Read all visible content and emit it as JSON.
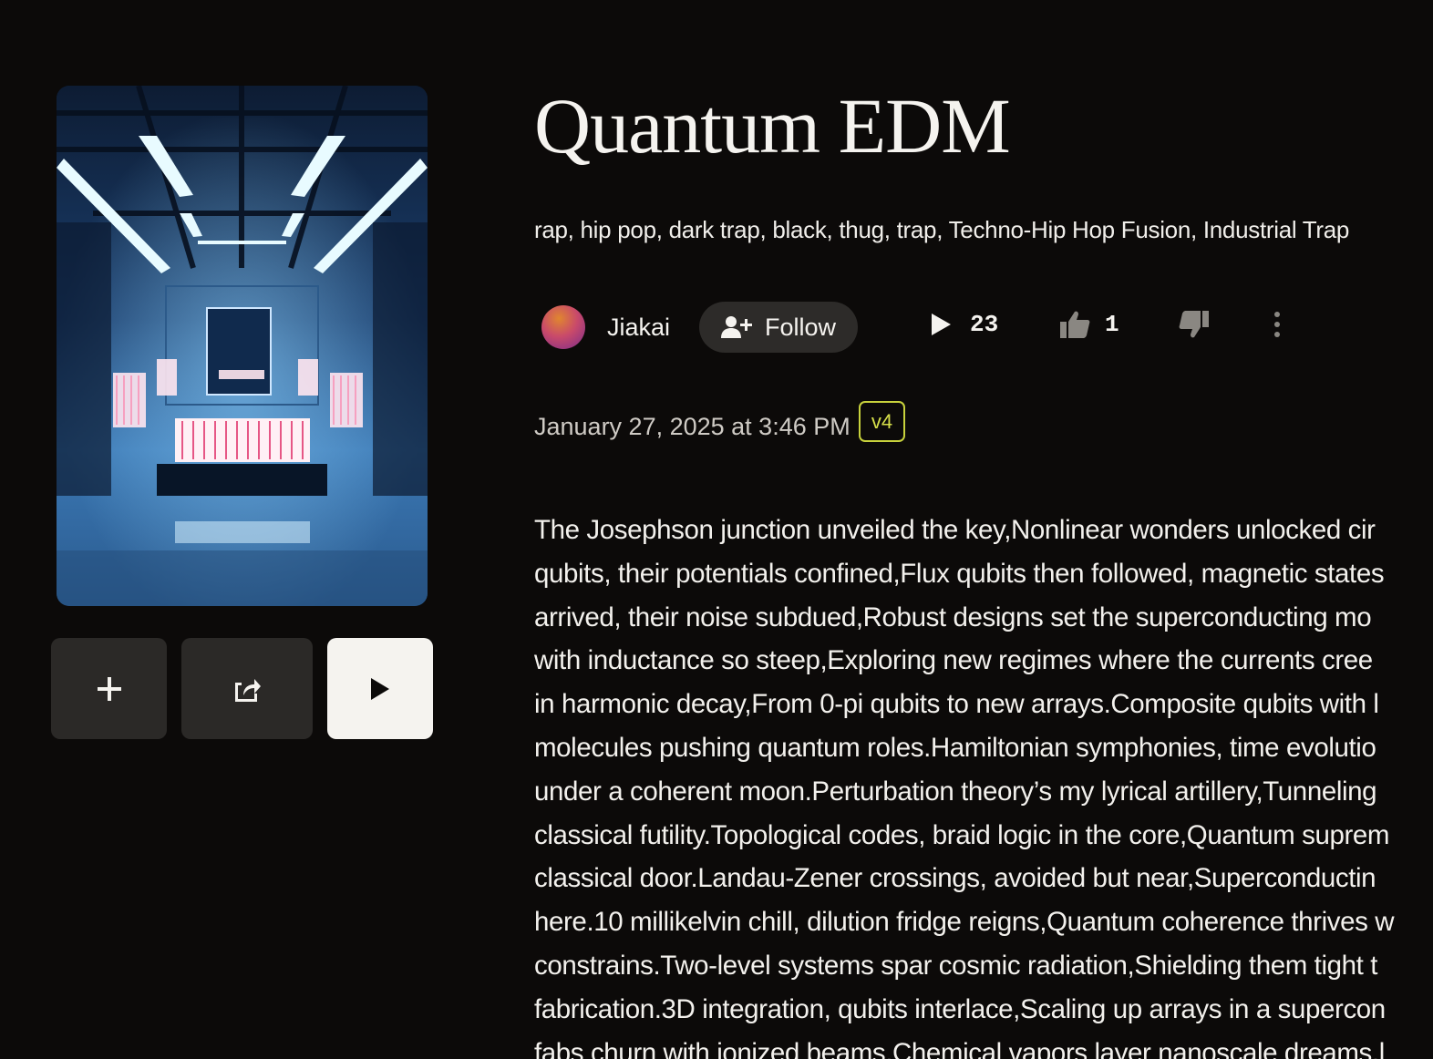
{
  "song": {
    "title": "Quantum EDM",
    "tags": "rap, hip pop, dark trap, black, thug, trap, Techno-Hip Hop Fusion, Industrial Trap",
    "author": "Jiakai",
    "follow_label": "Follow",
    "plays": "23",
    "likes": "1",
    "date": "January 27, 2025 at 3:46 PM",
    "version": "v4"
  },
  "actions": {
    "add_icon": "plus-icon",
    "share_icon": "share-icon",
    "play_icon": "play-icon"
  },
  "lyrics": [
    "The Josephson junction unveiled the key,Nonlinear wonders unlocked cir",
    "qubits, their potentials confined,Flux qubits then followed, magnetic states",
    "arrived, their noise subdued,Robust designs set the superconducting mo",
    "with inductance so steep,Exploring new regimes where the currents cree",
    "in harmonic decay,From 0-pi qubits to new arrays.Composite qubits with l",
    "molecules pushing quantum roles.Hamiltonian symphonies, time evolutio",
    "under a coherent moon.Perturbation theory’s my lyrical artillery,Tunneling",
    "classical futility.Topological codes, braid logic in the core,Quantum suprem",
    "classical door.Landau-Zener crossings, avoided but near,Superconductin",
    "here.10 millikelvin chill, dilution fridge reigns,Quantum coherence thrives w",
    "constrains.Two-level systems spar cosmic radiation,Shielding them tight t",
    "fabrication.3D integration, qubits interlace,Scaling up arrays in a supercon",
    "fabs churn with ionized beams,Chemical vapors layer nanoscale dreams,l"
  ],
  "colors": {
    "background": "#0c0a09",
    "button_dark": "#2b2927",
    "version_badge": "#c8d23c"
  }
}
